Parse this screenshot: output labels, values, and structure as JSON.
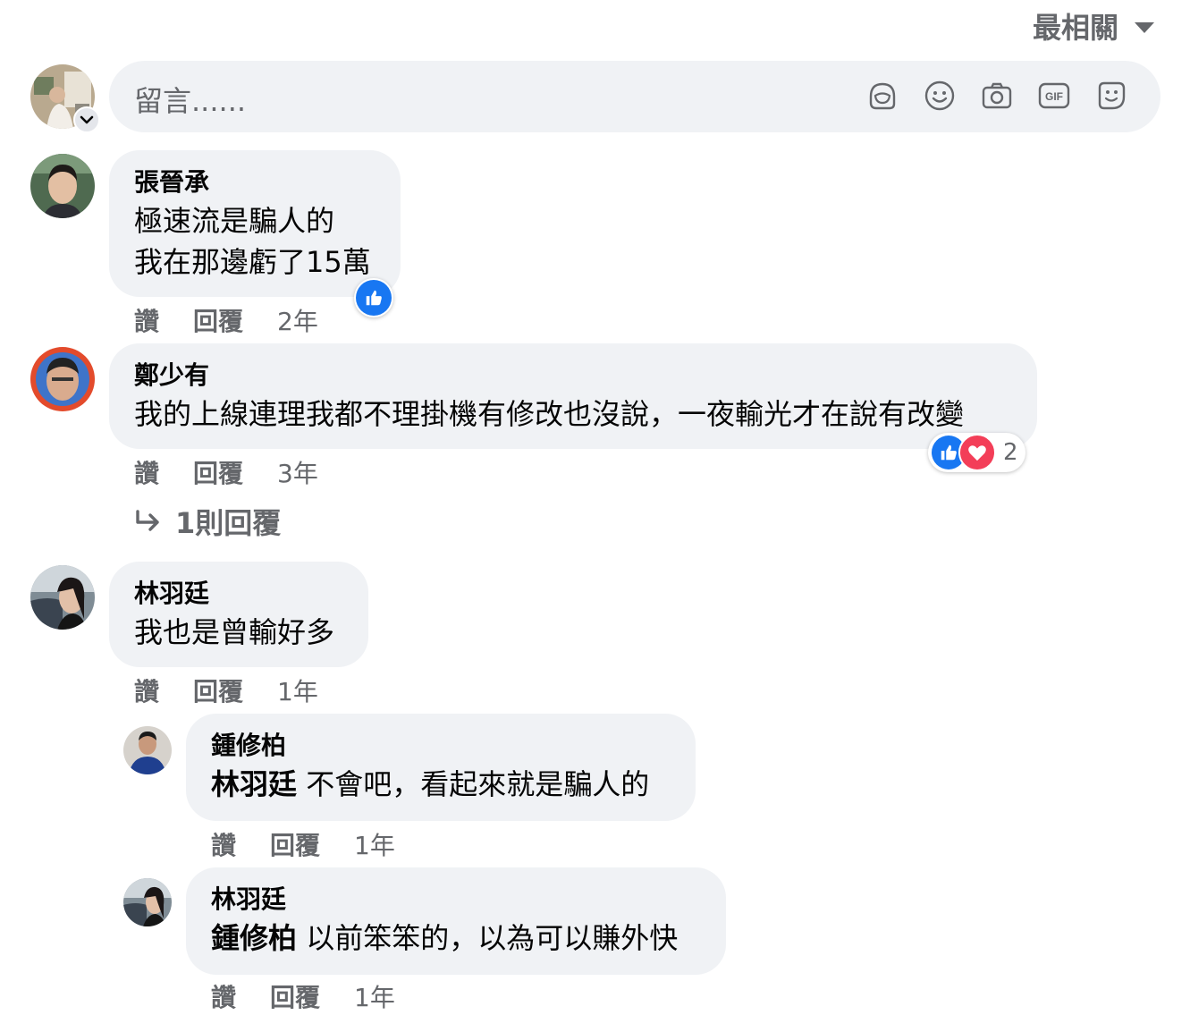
{
  "sort": {
    "label": "最相關",
    "icon": "caret-down-icon"
  },
  "composer": {
    "placeholder": "留言......",
    "tools": [
      "avatar-sticker-icon",
      "emoji-icon",
      "camera-icon",
      "gif-icon",
      "sticker-icon"
    ]
  },
  "comments": [
    {
      "author": "張晉承",
      "lines": [
        "極速流是騙人的",
        "我在那邊虧了15萬"
      ],
      "like": "讚",
      "reply": "回覆",
      "time": "2年",
      "reactions": [
        "like"
      ]
    },
    {
      "author": "鄭少有",
      "lines": [
        "我的上線連理我都不理掛機有修改也沒說，一夜輸光才在說有改變"
      ],
      "like": "讚",
      "reply": "回覆",
      "time": "3年",
      "reactions": [
        "like",
        "love"
      ],
      "reaction_count": "2",
      "replies_link": "1則回覆"
    },
    {
      "author": "林羽廷",
      "lines": [
        "我也是曾輸好多"
      ],
      "like": "讚",
      "reply": "回覆",
      "time": "1年",
      "replies": [
        {
          "author": "鍾修柏",
          "mention": "林羽廷",
          "text": " 不會吧，看起來就是騙人的",
          "like": "讚",
          "reply": "回覆",
          "time": "1年"
        },
        {
          "author": "林羽廷",
          "mention": "鍾修柏",
          "text": " 以前笨笨的，以為可以賺外快",
          "like": "讚",
          "reply": "回覆",
          "time": "1年"
        }
      ]
    }
  ],
  "colors": {
    "bubble": "#f0f2f5",
    "secondary_text": "#65676b",
    "like_blue": "#1877f2",
    "love_red": "#f33e58"
  }
}
